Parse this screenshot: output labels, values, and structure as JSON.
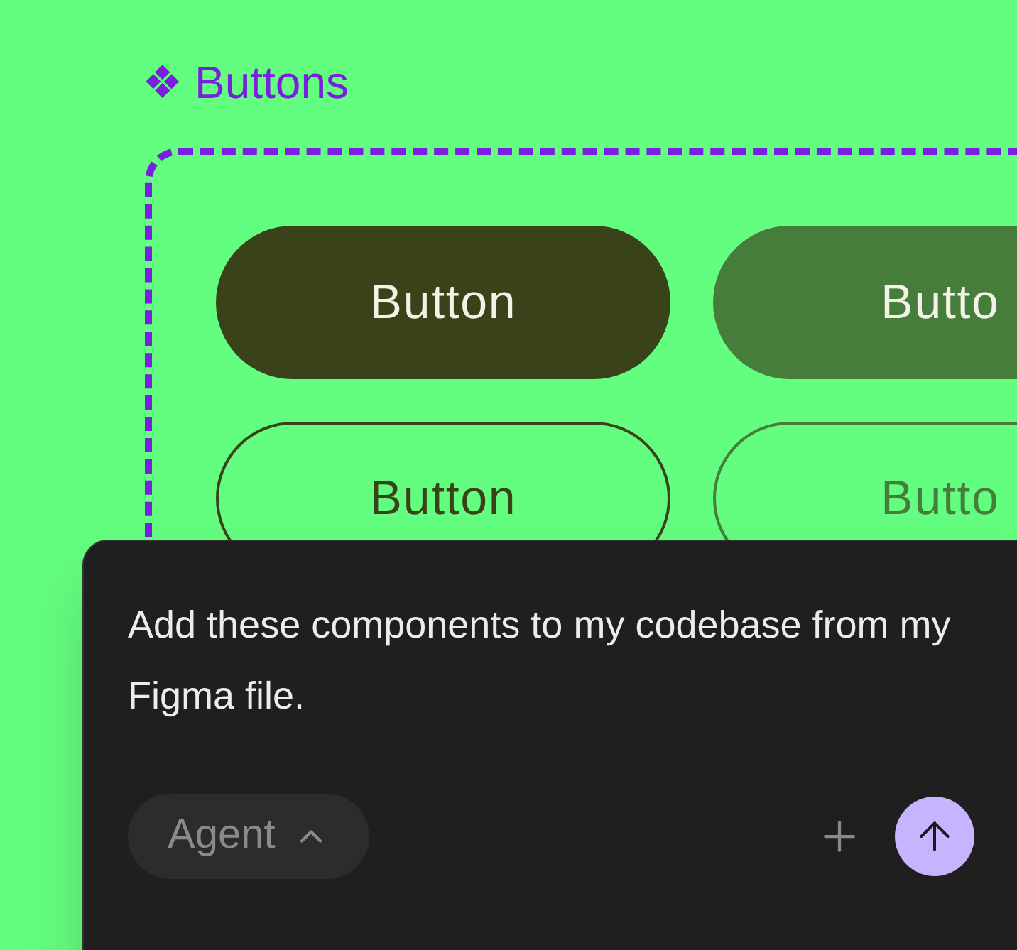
{
  "component": {
    "symbol": "❖",
    "title": "Buttons"
  },
  "buttons": [
    {
      "label": "Button",
      "kind": "filled",
      "color": "#3a4219"
    },
    {
      "label": "Butto",
      "kind": "filled",
      "color": "#477d3a"
    },
    {
      "label": "Button",
      "kind": "outline",
      "color": "#3a4219"
    },
    {
      "label": "Butto",
      "kind": "outline",
      "color": "#477d3a"
    }
  ],
  "chat": {
    "prompt": "Add these components to my codebase from my Figma file.",
    "mode": "Agent"
  }
}
